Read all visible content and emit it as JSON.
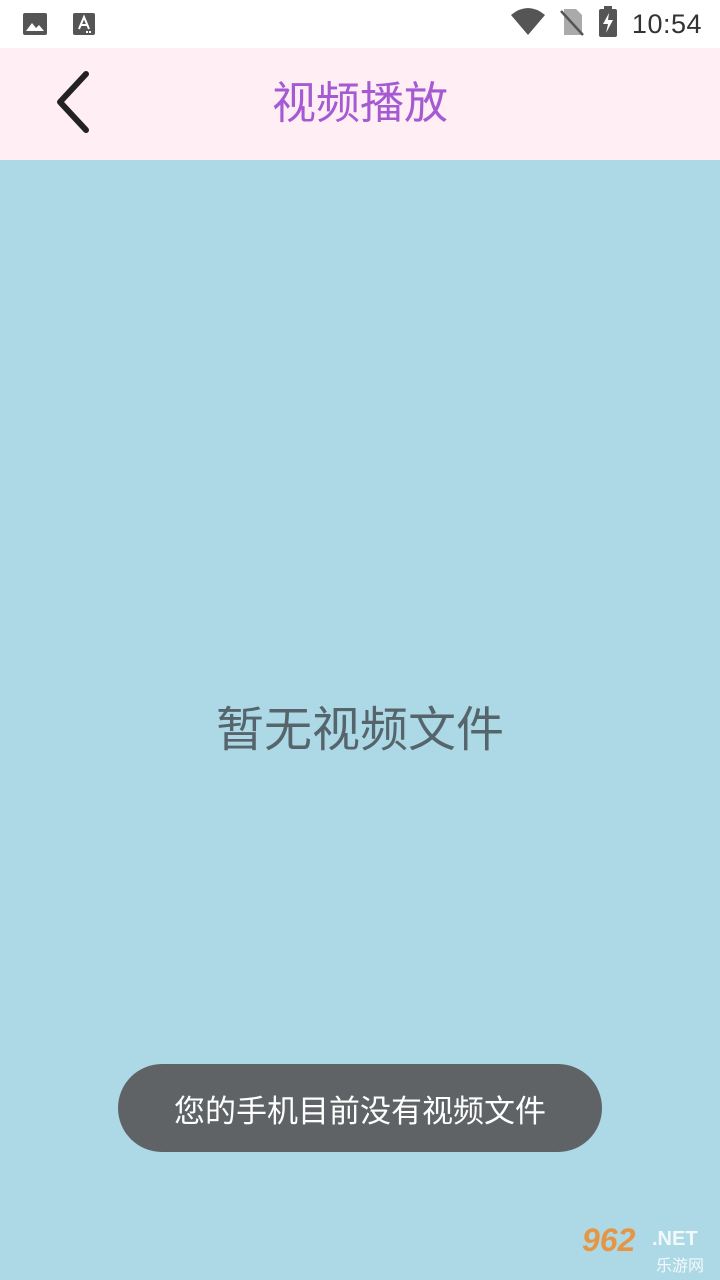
{
  "status_bar": {
    "time": "10:54",
    "icons": [
      "image-icon",
      "text-a-icon",
      "wifi-icon",
      "no-sim-icon",
      "battery-charging-icon"
    ]
  },
  "app_bar": {
    "back_icon": "chevron-left-icon",
    "title": "视频播放"
  },
  "main": {
    "empty_message": "暂无视频文件"
  },
  "toast": {
    "message": "您的手机目前没有视频文件"
  },
  "watermark": {
    "brand": "962",
    "suffix": ".NET",
    "subtitle": "乐游网"
  },
  "colors": {
    "background": "#add8e6",
    "app_bar": "#ffeef4",
    "title": "#a55ad3",
    "empty_text": "#56656c",
    "toast_bg": "#5f6366"
  }
}
